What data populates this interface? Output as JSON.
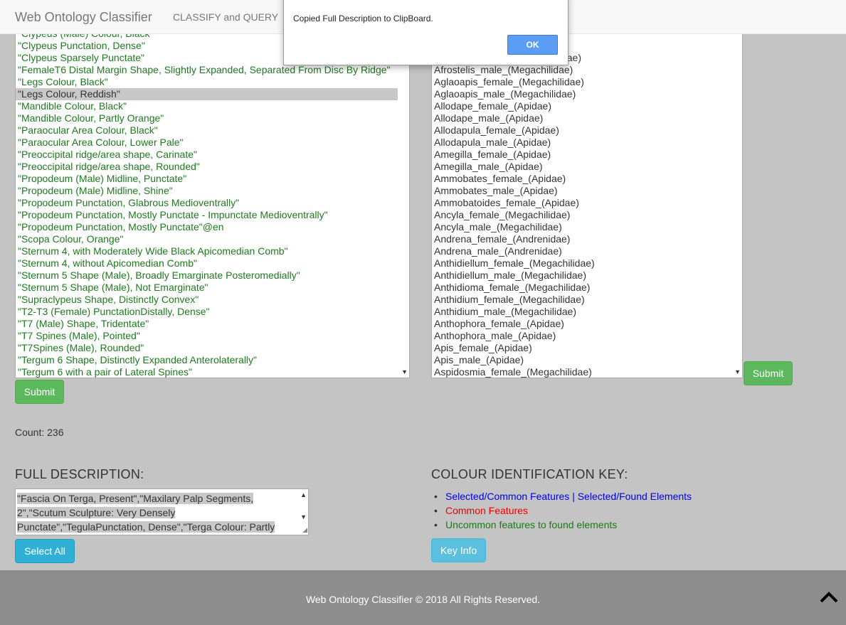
{
  "navbar": {
    "brand": "Web Ontology Classifier",
    "link": "CLASSIFY and QUERY"
  },
  "features": [
    {
      "label": "\"Clypeus (Male) Colour, Black\"",
      "selected": false
    },
    {
      "label": "\"Clypeus Punctation, Dense\"",
      "selected": false
    },
    {
      "label": "\"Clypeus Sparsely Punctate\"",
      "selected": false
    },
    {
      "label": "\"FemaleT6 Distal Margin Shape, Slightly Expanded, Separated From Disc By Ridge\"",
      "selected": false
    },
    {
      "label": "\"Legs Colour, Black\"",
      "selected": false
    },
    {
      "label": "\"Legs Colour, Reddish\"",
      "selected": true
    },
    {
      "label": "\"Mandible Colour, Black\"",
      "selected": false
    },
    {
      "label": "\"Mandible Colour, Partly Orange\"",
      "selected": false
    },
    {
      "label": "\"Paraocular Area Colour, Black\"",
      "selected": false
    },
    {
      "label": "\"Paraocular Area Colour, Lower Pale\"",
      "selected": false
    },
    {
      "label": "\"Preoccipital ridge/area shape, Carinate\"",
      "selected": false
    },
    {
      "label": "\"Preoccipital ridge/area shape, Rounded\"",
      "selected": false
    },
    {
      "label": "\"Propodeum (Male) Midline, Punctate\"",
      "selected": false
    },
    {
      "label": "\"Propodeum (Male) Midline, Shine\"",
      "selected": false
    },
    {
      "label": "\"Propodeum Punctation, Glabrous Medioventrally\"",
      "selected": false
    },
    {
      "label": "\"Propodeum Punctation, Mostly Punctate - Impunctate Medioventrally\"",
      "selected": false
    },
    {
      "label": "\"Propodeum Punctation, Mostly Punctate\"@en",
      "selected": false
    },
    {
      "label": "\"Scopa Colour, Orange\"",
      "selected": false
    },
    {
      "label": "\"Sternum 4, with Moderately Wide Black Apicomedian Comb\"",
      "selected": false
    },
    {
      "label": "\"Sternum 4, without Apicomedian Comb\"",
      "selected": false
    },
    {
      "label": "\"Sternum 5 Shape (Male), Broadly Emarginate Posteromedially\"",
      "selected": false
    },
    {
      "label": "\"Sternum 5 Shape (Male), Not Emarginate\"",
      "selected": false
    },
    {
      "label": "\"Supraclypeus Shape, Distinctly Convex\"",
      "selected": false
    },
    {
      "label": "\"T2-T3 (Female) PunctationDistally, Dense\"",
      "selected": false
    },
    {
      "label": "\"T7 (Male) Shape, Tridentate\"",
      "selected": false
    },
    {
      "label": "\"T7 Spines (Male), Pointed\"",
      "selected": false
    },
    {
      "label": "\"T7Spines (Male), Rounded\"",
      "selected": false
    },
    {
      "label": "\"Tergum 6 Shape, Distinctly Expanded Anterolaterally\"",
      "selected": false
    },
    {
      "label": "\"Tergum 6 with a pair of Lateral Spines\"",
      "selected": false
    }
  ],
  "classes": [
    "Afrostelis_female_(Megachilidae)",
    "Afrostelis_male_(Megachilidae)",
    "Aglaoapis_female_(Megachilidae)",
    "Aglaoapis_male_(Megachilidae)",
    "Allodape_female_(Apidae)",
    "Allodape_male_(Apidae)",
    "Allodapula_female_(Apidae)",
    "Allodapula_male_(Apidae)",
    "Amegilla_female_(Apidae)",
    "Amegilla_male_(Apidae)",
    "Ammobates_female_(Apidae)",
    "Ammobates_male_(Apidae)",
    "Ammobatoides_female_(Apidae)",
    "Ancyla_female_(Megachilidae)",
    "Ancyla_male_(Megachilidae)",
    "Andrena_female_(Andrenidae)",
    "Andrena_male_(Andrenidae)",
    "Anthidiellum_female_(Megachilidae)",
    "Anthidiellum_male_(Megachilidae)",
    "Anthidioma_female_(Megachilidae)",
    "Anthidium_female_(Megachilidae)",
    "Anthidium_male_(Megachilidae)",
    "Anthophora_female_(Apidae)",
    "Anthophora_male_(Apidae)",
    "Apis_female_(Apidae)",
    "Apis_male_(Apidae)",
    "Aspidosmia_female_(Megachilidae)"
  ],
  "buttons": {
    "submit": "Submit",
    "select_all": "Select All",
    "key_info": "Key Info"
  },
  "count": "Count: 236",
  "full_description": {
    "title": "FULL DESCRIPTION:",
    "lines": [
      "\"Fascia On Terga, Present\",\"Maxilary Palp Segments,",
      "2\",\"Scutum Sculpture: Very Densely",
      "Punctate\",\"TegulaPunctation, Dense\",\"Terga Colour: Partly"
    ]
  },
  "colour_key": {
    "title": "COLOUR IDENTIFICATION KEY:",
    "items": [
      {
        "label": "Selected/Common Features | Selected/Found Elements",
        "color": "#0000ee"
      },
      {
        "label": "Common Features",
        "color": "#ee0000"
      },
      {
        "label": "Uncommon features to found elements",
        "color": "#1a7a1a"
      }
    ]
  },
  "footer": {
    "text": "Web Ontology Classifier © 2018 All Rights Reserved.",
    "icon": "chevron-up-icon"
  },
  "dialog": {
    "message": "Copied Full Description to ClipBoard.",
    "ok": "OK"
  }
}
